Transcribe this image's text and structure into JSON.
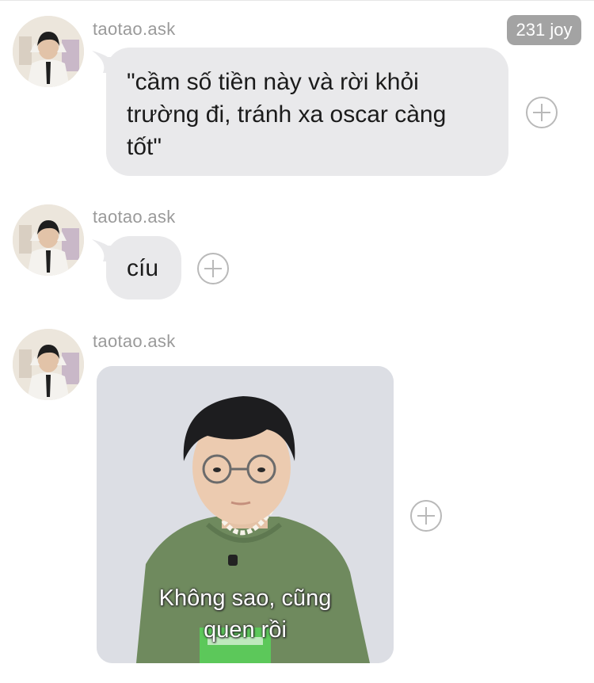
{
  "badge": "231 joy",
  "messages": [
    {
      "sender": "taotao.ask",
      "text_lines": [
        "\"cầm số tiền này và rời khỏi",
        "trường đi, tránh xa oscar càng",
        "tốt\""
      ]
    },
    {
      "sender": "taotao.ask",
      "text": "cíu"
    },
    {
      "sender": "taotao.ask",
      "sticker_caption_lines": [
        "Không sao, cũng",
        "quen rồi"
      ]
    }
  ],
  "icons": {
    "react": "plus-circle-icon",
    "avatar": "avatar-photo"
  },
  "colors": {
    "bubble": "#e9e9eb",
    "sender": "#9a9a9a",
    "badge": "#a3a3a3"
  }
}
